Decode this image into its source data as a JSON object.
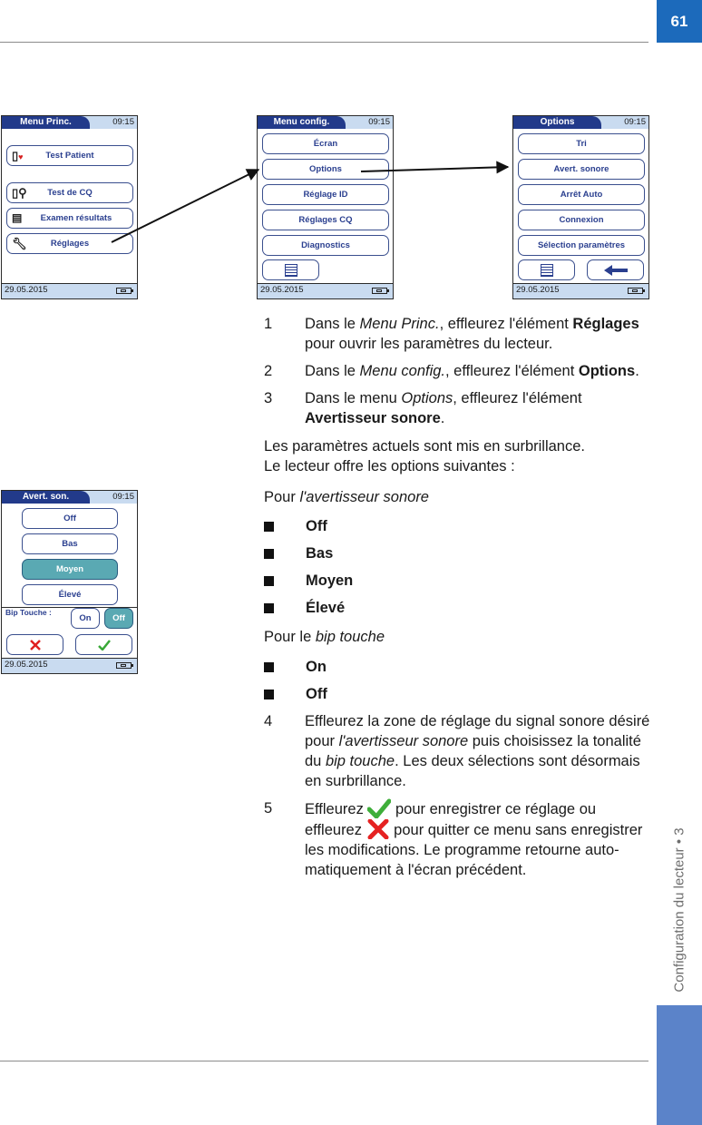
{
  "page": {
    "number": "61",
    "chapter": "Configuration du lecteur • 3",
    "colors": {
      "page_tab": "#1c6abb",
      "side_tab": "#5b83c9",
      "screen_header": "#223a8a",
      "screen_bar": "#c9dbf0",
      "selected": "#5aa9b3",
      "button_text": "#2a3f8f"
    }
  },
  "screens": {
    "main_menu": {
      "title": "Menu Princ.",
      "time": "09:15",
      "date": "29.05.2015",
      "buttons": [
        {
          "label": "Test Patient",
          "icon": "test-strip-drop-icon"
        },
        {
          "label": "Test de CQ",
          "icon": "test-strip-qc-icon"
        },
        {
          "label": "Examen résultats",
          "icon": "results-review-icon"
        },
        {
          "label": "Réglages",
          "icon": "wrench-icon"
        }
      ]
    },
    "config_menu": {
      "title": "Menu config.",
      "time": "09:15",
      "date": "29.05.2015",
      "buttons": [
        {
          "label": "Écran"
        },
        {
          "label": "Options"
        },
        {
          "label": "Réglage ID"
        },
        {
          "label": "Réglages CQ"
        },
        {
          "label": "Diagnostics"
        }
      ],
      "bottom_icon": "list-icon"
    },
    "options_menu": {
      "title": "Options",
      "time": "09:15",
      "date": "29.05.2015",
      "buttons": [
        {
          "label": "Tri"
        },
        {
          "label": "Avert. sonore"
        },
        {
          "label": "Arrêt Auto"
        },
        {
          "label": "Connexion"
        },
        {
          "label": "Sélection paramètres"
        }
      ],
      "bottom_icons": [
        "list-icon",
        "back-arrow-icon"
      ]
    },
    "beeper_menu": {
      "title": "Avert. son.",
      "time": "09:15",
      "date": "29.05.2015",
      "levels": [
        {
          "label": "Off",
          "selected": false
        },
        {
          "label": "Bas",
          "selected": false
        },
        {
          "label": "Moyen",
          "selected": true
        },
        {
          "label": "Élevé",
          "selected": false
        }
      ],
      "key_beep_label": "Bip Touche :",
      "key_beep": [
        {
          "label": "On",
          "selected": false
        },
        {
          "label": "Off",
          "selected": true
        }
      ],
      "cancel_icon": "cross-icon",
      "confirm_icon": "check-icon"
    }
  },
  "instructions": {
    "step1": {
      "num": "1",
      "a": "Dans le ",
      "a_i": "Menu Princ.",
      "b": ", effleurez l'élément ",
      "b_b": "Réglages",
      "c": " pour ouvrir les paramètres du lecteur."
    },
    "step2": {
      "num": "2",
      "a": "Dans le ",
      "a_i": "Menu config.",
      "b": ", effleurez l'élément ",
      "b_b": "Options",
      "c": "."
    },
    "step3": {
      "num": "3",
      "a": "Dans le menu ",
      "a_i": "Options",
      "b": ", effleurez l'élément ",
      "b_b": "Avertisseur sonore",
      "c": "."
    },
    "intro_line1": "Les paramètres actuels sont mis en surbrillance.",
    "intro_line2": "Le lecteur offre les options suivantes :",
    "beeper_heading": {
      "a": "Pour ",
      "a_i": "l'avertisseur sonore"
    },
    "beeper_options": [
      "Off",
      "Bas",
      "Moyen",
      "Élevé"
    ],
    "keybeep_heading": {
      "a": "Pour le ",
      "a_i": "bip touche"
    },
    "keybeep_options": [
      "On",
      "Off"
    ],
    "step4": {
      "num": "4",
      "a": "Effleurez la zone de réglage du signal sonore désiré pour ",
      "a_i": "l'avertisseur sonore",
      "b": " puis choisissez la tonalité du ",
      "b_i": "bip touche",
      "c": ". Les deux sélections sont désormais en surbrillance."
    },
    "step5": {
      "num": "5",
      "a": "Effleurez ",
      "b": " pour enregistrer ce réglage ou effleurez ",
      "c": " pour quitter ce menu sans enregistrer les modifications. Le programme retourne auto-matiquement à l'écran précédent."
    }
  }
}
